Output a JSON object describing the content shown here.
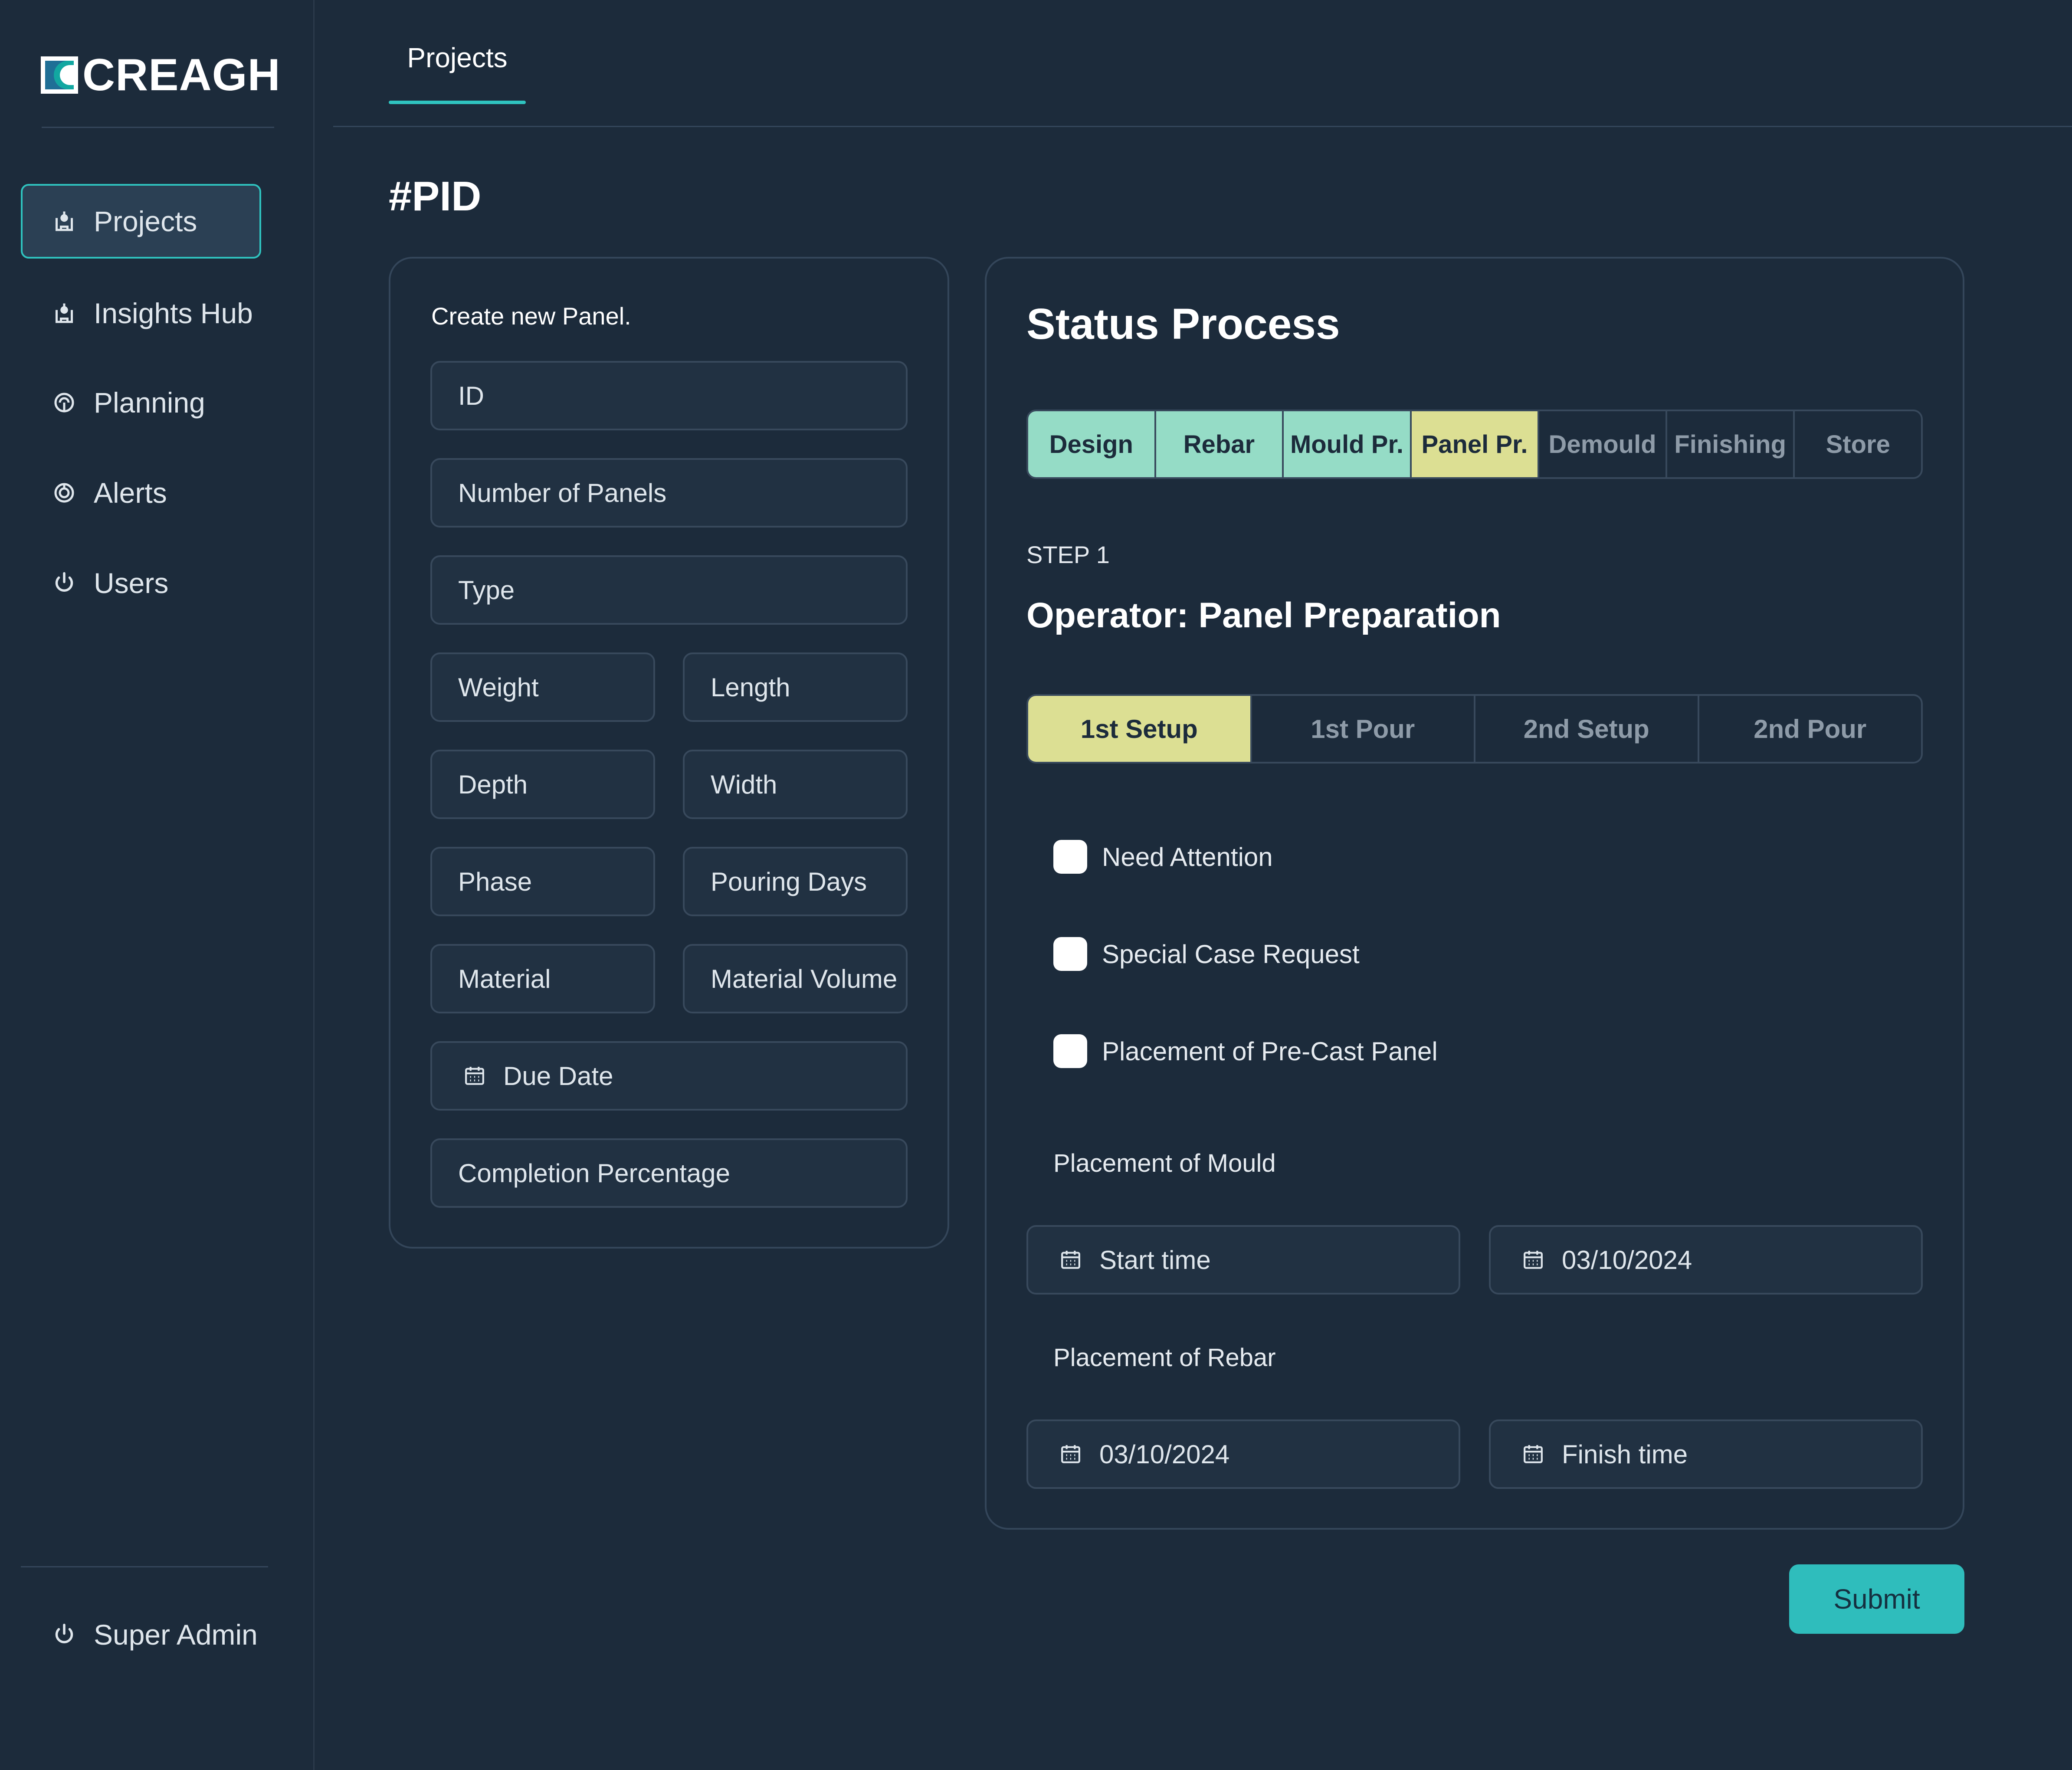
{
  "brand": {
    "logo_text": "CREAGH"
  },
  "sidebar": {
    "items": [
      {
        "label": "Projects",
        "icon": "projects-icon",
        "active": true
      },
      {
        "label": "Insights Hub",
        "icon": "insights-icon",
        "active": false
      },
      {
        "label": "Planning",
        "icon": "planning-icon",
        "active": false
      },
      {
        "label": "Alerts",
        "icon": "alerts-icon",
        "active": false
      },
      {
        "label": "Users",
        "icon": "power-icon",
        "active": false
      }
    ],
    "footer": {
      "label": "Super Admin",
      "icon": "power-icon"
    }
  },
  "topbar": {
    "tab_label": "Projects"
  },
  "page": {
    "title": "#PID"
  },
  "form": {
    "caption": "Create new Panel.",
    "fields": {
      "id": "ID",
      "number_of_panels": "Number of Panels",
      "type": "Type",
      "weight": "Weight",
      "length": "Length",
      "depth": "Depth",
      "width": "Width",
      "phase": "Phase",
      "pouring_days": "Pouring Days",
      "material": "Material",
      "material_volume": "Material Volume",
      "due_date": "Due Date",
      "completion_percentage": "Completion Percentage"
    }
  },
  "status": {
    "title": "Status Process",
    "steps": [
      {
        "label": "Design",
        "state": "done"
      },
      {
        "label": "Rebar",
        "state": "done"
      },
      {
        "label": "Mould Pr.",
        "state": "done"
      },
      {
        "label": "Panel Pr.",
        "state": "current"
      },
      {
        "label": "Demould",
        "state": "pending"
      },
      {
        "label": "Finishing",
        "state": "pending"
      },
      {
        "label": "Store",
        "state": "pending"
      }
    ],
    "step_label": "STEP 1",
    "operator_title": "Operator: Panel Preparation",
    "subtabs": [
      {
        "label": "1st Setup",
        "active": true
      },
      {
        "label": "1st Pour",
        "active": false
      },
      {
        "label": "2nd Setup",
        "active": false
      },
      {
        "label": "2nd Pour",
        "active": false
      }
    ],
    "checks": [
      {
        "label": "Need Attention",
        "checked": false
      },
      {
        "label": "Special Case Request",
        "checked": false
      },
      {
        "label": "Placement of Pre-Cast Panel",
        "checked": false
      }
    ],
    "mould": {
      "label": "Placement of Mould",
      "start_placeholder": "Start time",
      "end_value": "03/10/2024"
    },
    "rebar": {
      "label": "Placement of Rebar",
      "start_value": "03/10/2024",
      "end_placeholder": "Finish time"
    }
  },
  "actions": {
    "submit_label": "Submit"
  },
  "colors": {
    "background": "#1c2b3b",
    "accent": "#2fc3bf",
    "step_done": "#95dcc6",
    "step_current": "#dcdf93"
  }
}
